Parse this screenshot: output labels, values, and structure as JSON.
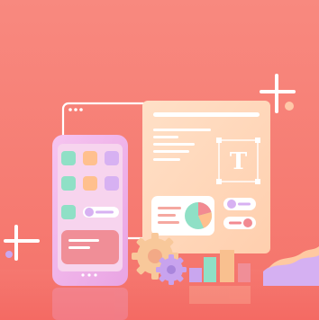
{
  "scene": {
    "description_free": true,
    "palette": {
      "background_top": "#f7897f",
      "background_bottom": "#f5776e",
      "floor": "#f46f67",
      "panel_peach": "#ffd6b8",
      "phone_frame": "#efb1e9",
      "phone_screen": "#f7d4ee",
      "mint": "#8fe0c6",
      "orange": "#ffc08e",
      "lavender": "#d7b1f2",
      "card_pink": "#f08e97",
      "gear_peach": "#f8c89a",
      "gear_lavender": "#c8a3ee",
      "white": "#ffffff"
    }
  },
  "editor_panel": {
    "text_tool_glyph": "T"
  }
}
